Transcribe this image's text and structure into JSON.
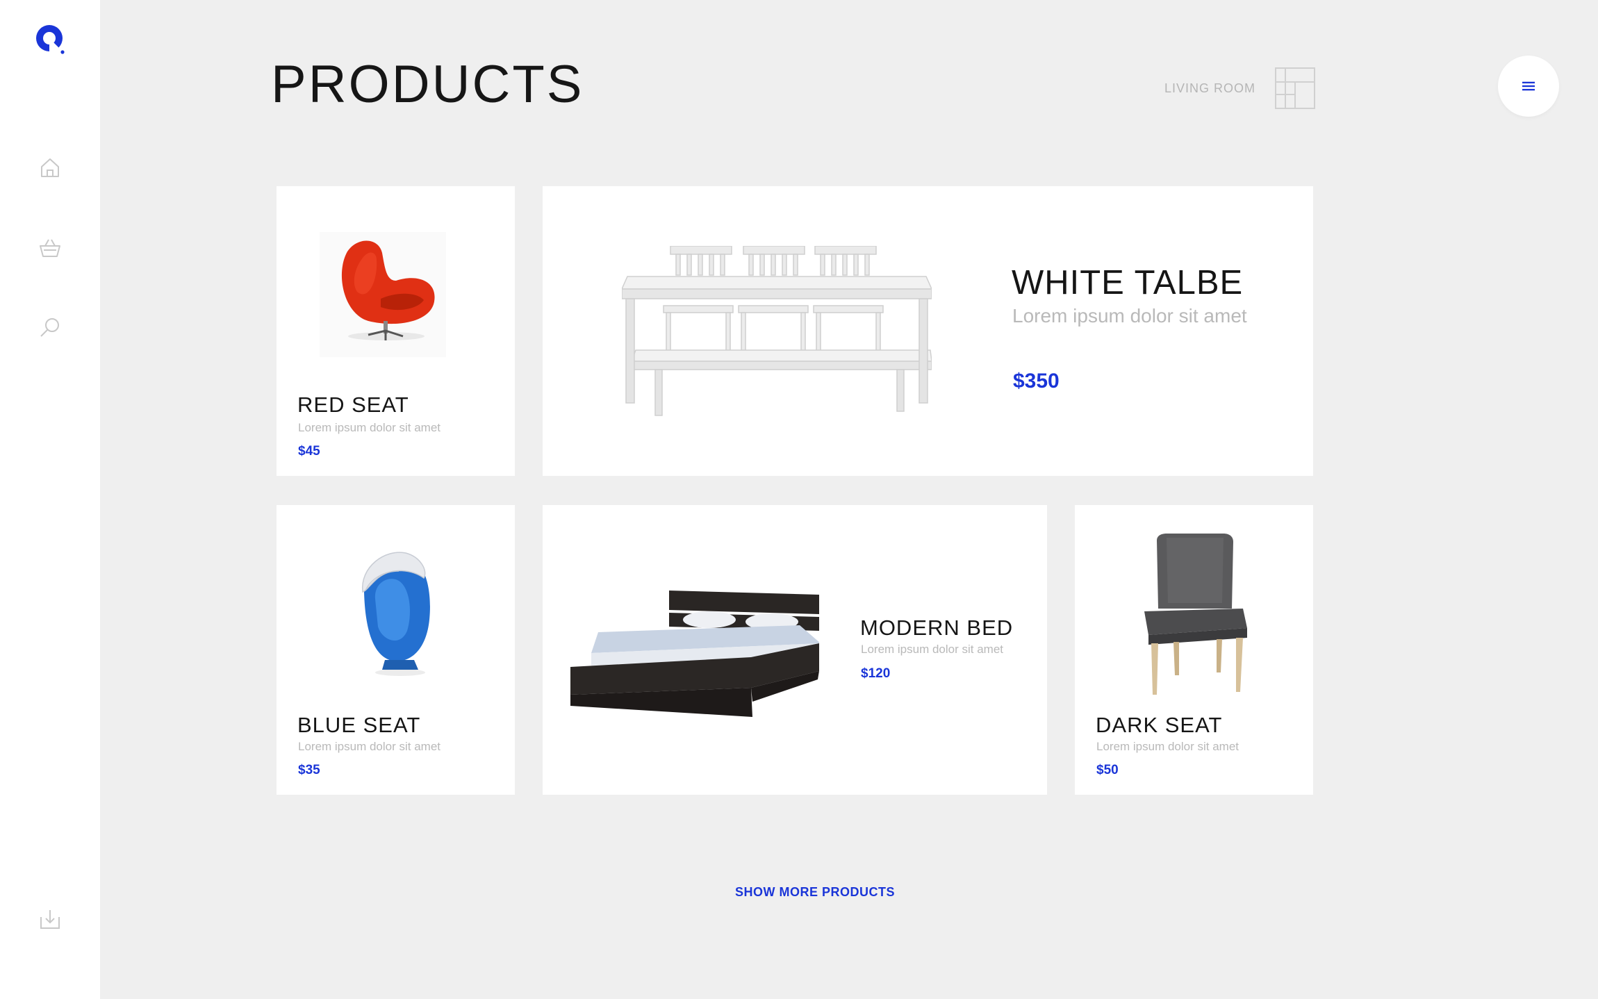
{
  "header": {
    "title": "PRODUCTS",
    "room_label": "LIVING ROOM"
  },
  "sidebar": {
    "icons": [
      "home-icon",
      "basket-icon",
      "search-icon",
      "download-icon"
    ]
  },
  "products": {
    "red_seat": {
      "name": "RED SEAT",
      "desc": "Lorem ipsum dolor sit amet",
      "price": "$45"
    },
    "white_table": {
      "name": "WHITE TALBE",
      "desc": "Lorem ipsum dolor sit amet",
      "price": "$350"
    },
    "blue_seat": {
      "name": "BLUE SEAT",
      "desc": "Lorem ipsum dolor sit amet",
      "price": "$35"
    },
    "modern_bed": {
      "name": "MODERN BED",
      "desc": "Lorem ipsum dolor sit amet",
      "price": "$120"
    },
    "dark_seat": {
      "name": "DARK SEAT",
      "desc": "Lorem ipsum dolor sit amet",
      "price": "$50"
    }
  },
  "footer": {
    "show_more": "SHOW MORE PRODUCTS"
  },
  "colors": {
    "accent": "#1a35d8",
    "background": "#efefef",
    "card": "#ffffff",
    "muted_text": "#b9b9b9"
  }
}
